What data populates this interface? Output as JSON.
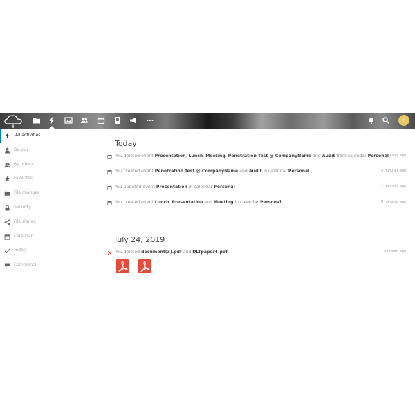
{
  "header": {
    "avatar_initial": "F",
    "nav_icons": [
      "files-icon",
      "activity-icon",
      "gallery-icon",
      "contacts-icon",
      "calendar-icon",
      "deck-icon",
      "announcements-icon",
      "more-icon"
    ],
    "right_icons": [
      "notifications-icon",
      "search-icon"
    ]
  },
  "sidebar": {
    "items": [
      {
        "label": "All activities",
        "icon": "lightning-icon",
        "active": true
      },
      {
        "label": "By you",
        "icon": "user-icon",
        "active": false
      },
      {
        "label": "By others",
        "icon": "users-icon",
        "active": false
      },
      {
        "label": "Favorites",
        "icon": "star-icon",
        "active": false
      },
      {
        "label": "File changes",
        "icon": "folder-icon",
        "active": false
      },
      {
        "label": "Security",
        "icon": "lock-icon",
        "active": false
      },
      {
        "label": "File shares",
        "icon": "share-icon",
        "active": false
      },
      {
        "label": "Calendar",
        "icon": "calendar-icon",
        "active": false
      },
      {
        "label": "Todos",
        "icon": "checkmark-icon",
        "active": false
      },
      {
        "label": "Comments",
        "icon": "comment-icon",
        "active": false
      }
    ]
  },
  "sections": [
    {
      "heading": "Today",
      "activities": [
        {
          "icon": "calendar-icon",
          "parts": [
            {
              "t": "You deleted event ",
              "b": false
            },
            {
              "t": "Presentation",
              "b": true
            },
            {
              "t": ", ",
              "b": false
            },
            {
              "t": "Lunch",
              "b": true
            },
            {
              "t": ", ",
              "b": false
            },
            {
              "t": "Meeting",
              "b": true
            },
            {
              "t": ", ",
              "b": false
            },
            {
              "t": "Penetration Test @ CompanyName",
              "b": true
            },
            {
              "t": " and ",
              "b": false
            },
            {
              "t": "Audit",
              "b": true
            },
            {
              "t": " from calendar ",
              "b": false
            },
            {
              "t": "Personal",
              "b": true
            }
          ],
          "time": "4 minutes ago"
        },
        {
          "icon": "calendar-icon",
          "parts": [
            {
              "t": "You created event ",
              "b": false
            },
            {
              "t": "Penetration Test @ CompanyName",
              "b": true
            },
            {
              "t": " and ",
              "b": false
            },
            {
              "t": "Audit",
              "b": true
            },
            {
              "t": " in calendar ",
              "b": false
            },
            {
              "t": "Personal",
              "b": true
            }
          ],
          "time": "5 minutes ago"
        },
        {
          "icon": "calendar-icon",
          "parts": [
            {
              "t": "You updated event ",
              "b": false
            },
            {
              "t": "Presentation",
              "b": true
            },
            {
              "t": " in calendar ",
              "b": false
            },
            {
              "t": "Personal",
              "b": true
            }
          ],
          "time": "7 minutes ago"
        },
        {
          "icon": "calendar-icon",
          "parts": [
            {
              "t": "You created event ",
              "b": false
            },
            {
              "t": "Lunch",
              "b": true
            },
            {
              "t": ", ",
              "b": false
            },
            {
              "t": "Presentation",
              "b": true
            },
            {
              "t": " and ",
              "b": false
            },
            {
              "t": "Meeting",
              "b": true
            },
            {
              "t": " in calendar ",
              "b": false
            },
            {
              "t": "Personal",
              "b": true
            }
          ],
          "time": "8 minutes ago"
        }
      ]
    },
    {
      "heading": "July 24, 2019",
      "activities": [
        {
          "icon": "delete-icon",
          "parts": [
            {
              "t": "You deleted ",
              "b": false
            },
            {
              "t": "document(3).pdf",
              "b": true
            },
            {
              "t": " and ",
              "b": false
            },
            {
              "t": "DLTpaper4.pdf",
              "b": true
            }
          ],
          "time": "a month ago",
          "thumbnails": [
            "pdf-icon",
            "pdf-icon"
          ]
        }
      ]
    }
  ],
  "colors": {
    "accent": "#0082c9",
    "pdf_red": "#e64a3b",
    "delete_red": "#e9322d",
    "avatar": "#e8c769"
  }
}
